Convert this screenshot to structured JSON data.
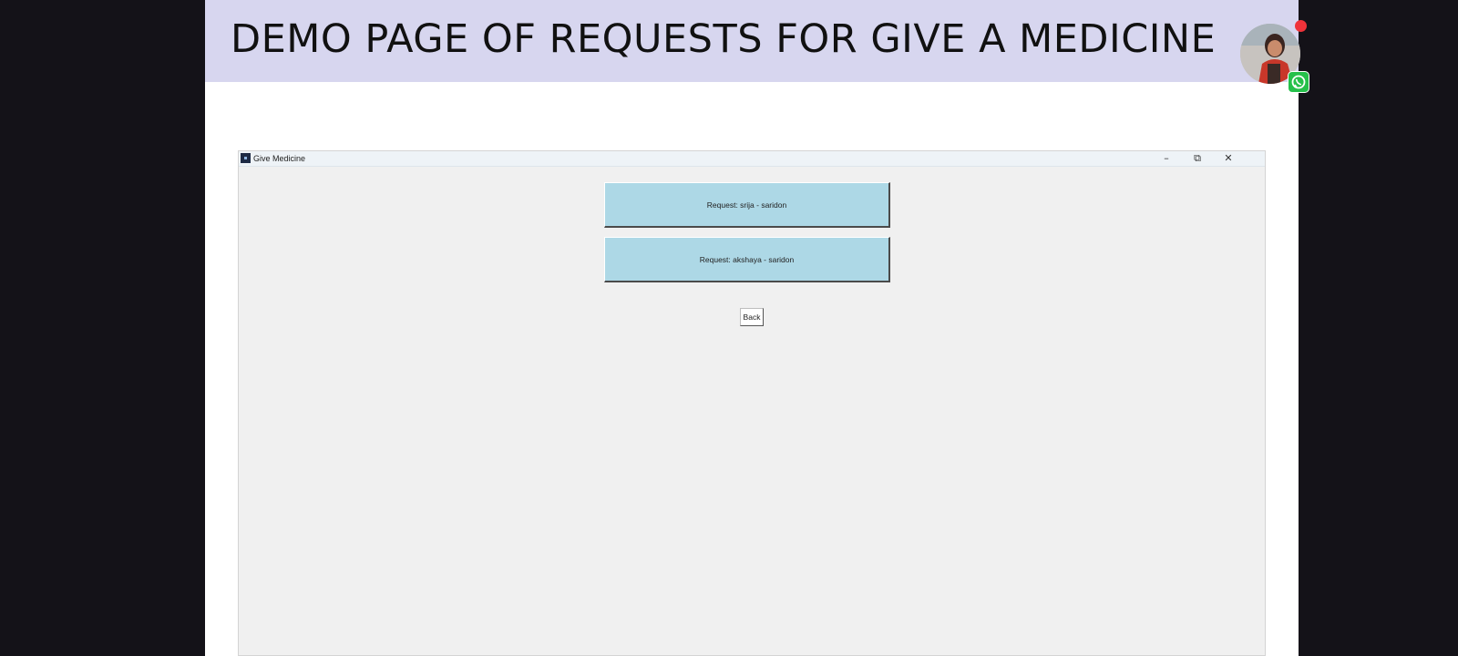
{
  "slide": {
    "title": "DEMO PAGE OF REQUESTS FOR GIVE A MEDICINE"
  },
  "overlay": {
    "avatar_icon": "person-avatar",
    "recording_indicator_icon": "red-dot",
    "whatsapp_icon": "whatsapp-icon"
  },
  "window": {
    "title": "Give Medicine",
    "controls": {
      "minimize": "–",
      "restore": "⧉",
      "close": "✕"
    },
    "requests": [
      {
        "label": "Request: srija - saridon"
      },
      {
        "label": "Request: akshaya - saridon"
      }
    ],
    "back_label": "Back"
  },
  "colors": {
    "banner_bg": "#d7d6ef",
    "button_bg": "#add8e6",
    "window_bg": "#f0f0f0",
    "outer_bg": "#141218",
    "whatsapp_green": "#25c04a",
    "record_red": "#f0333a"
  }
}
